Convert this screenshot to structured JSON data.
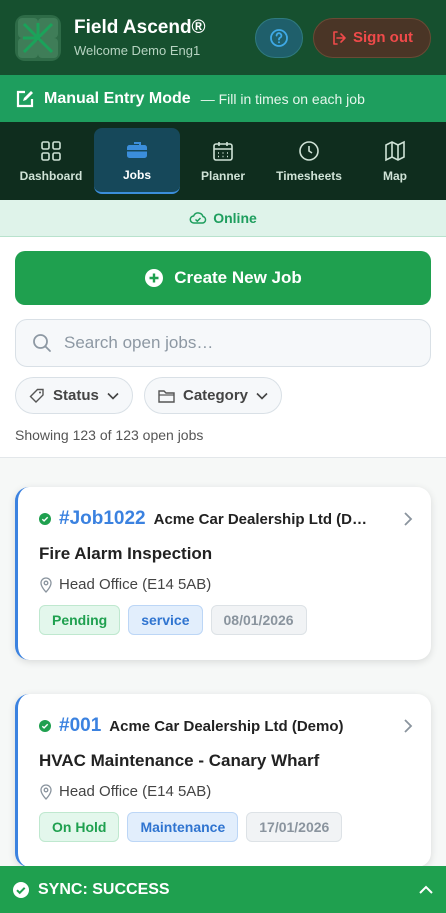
{
  "header": {
    "app_title": "Field Ascend®",
    "welcome": "Welcome Demo Eng1",
    "signout_label": "Sign out"
  },
  "manual_mode": {
    "label": "Manual Entry Mode",
    "hint": "— Fill in times on each job"
  },
  "nav": {
    "items": [
      {
        "label": "Dashboard",
        "icon": "grid-icon"
      },
      {
        "label": "Jobs",
        "icon": "briefcase-icon",
        "active": true
      },
      {
        "label": "Planner",
        "icon": "calendar-icon"
      },
      {
        "label": "Timesheets",
        "icon": "clock-icon"
      },
      {
        "label": "Map",
        "icon": "map-icon"
      }
    ]
  },
  "status": {
    "online_label": "Online"
  },
  "actions": {
    "create_label": "Create New Job"
  },
  "search": {
    "placeholder": "Search open jobs…",
    "value": ""
  },
  "filters": {
    "status_label": "Status",
    "category_label": "Category"
  },
  "summary": {
    "count_text": "Showing 123 of 123 open jobs"
  },
  "jobs": [
    {
      "number": "#Job1022",
      "client": "Acme Car Dealership Ltd (Demo)",
      "title": "Fire Alarm Inspection",
      "location": "Head Office (E14 5AB)",
      "status": "Pending",
      "category": "service",
      "date": "08/01/2026"
    },
    {
      "number": "#001",
      "client": "Acme Car Dealership Ltd (Demo)",
      "title": "HVAC Maintenance - Canary Wharf",
      "location": "Head Office (E14 5AB)",
      "status": "On Hold",
      "category": "Maintenance",
      "date": "17/01/2026"
    }
  ],
  "sync": {
    "label": "SYNC: SUCCESS"
  },
  "colors": {
    "header_bg": "#16502f",
    "accent_green": "#1fa04f",
    "accent_blue": "#3b82e0",
    "signout_red": "#f04a4a"
  }
}
